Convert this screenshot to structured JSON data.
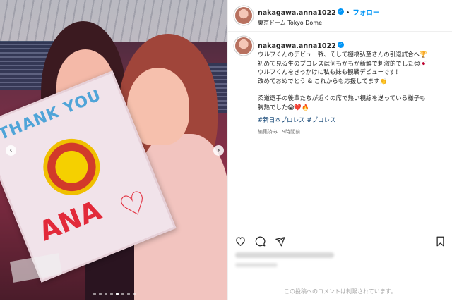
{
  "post": {
    "username": "nakagawa.anna1022",
    "follow_label": "フォロー",
    "location": "東京ドーム Tokyo Dome",
    "caption_lines": [
      "ウルフくんのデビュー戦、そして棚橋弘至さんの引退試合へ🏆",
      "初めて見る生のプロレスは何もかもが新鮮で刺激的でした😊🇯🇵",
      "ウルフくんをきっかけに私も妹も観戦デビューです！",
      "改めておめでとう & これからも応援してます👏",
      "柔道選手の後輩たちが近くの席で熱い視線を送っている様子も",
      "胸熱でした😱❤️🔥"
    ],
    "hashtags": "#新日本プロレス #プロレス",
    "meta": "編集済み · 9時間前",
    "comments_disabled": "この投稿へのコメントは制限されています。",
    "photo_sign": {
      "line1": "THANK YOU",
      "line2": "ANA",
      "heart": "♡"
    }
  },
  "carousel": {
    "prev_glyph": "‹",
    "next_glyph": "›",
    "dot_count": 8,
    "active_dot": 4
  },
  "colors": {
    "accent": "#0095f6",
    "hashtag": "#00376b",
    "muted": "#737373"
  },
  "icons": [
    "verified-badge-icon",
    "heart-icon",
    "comment-icon",
    "share-icon",
    "bookmark-icon",
    "more-options-icon"
  ]
}
